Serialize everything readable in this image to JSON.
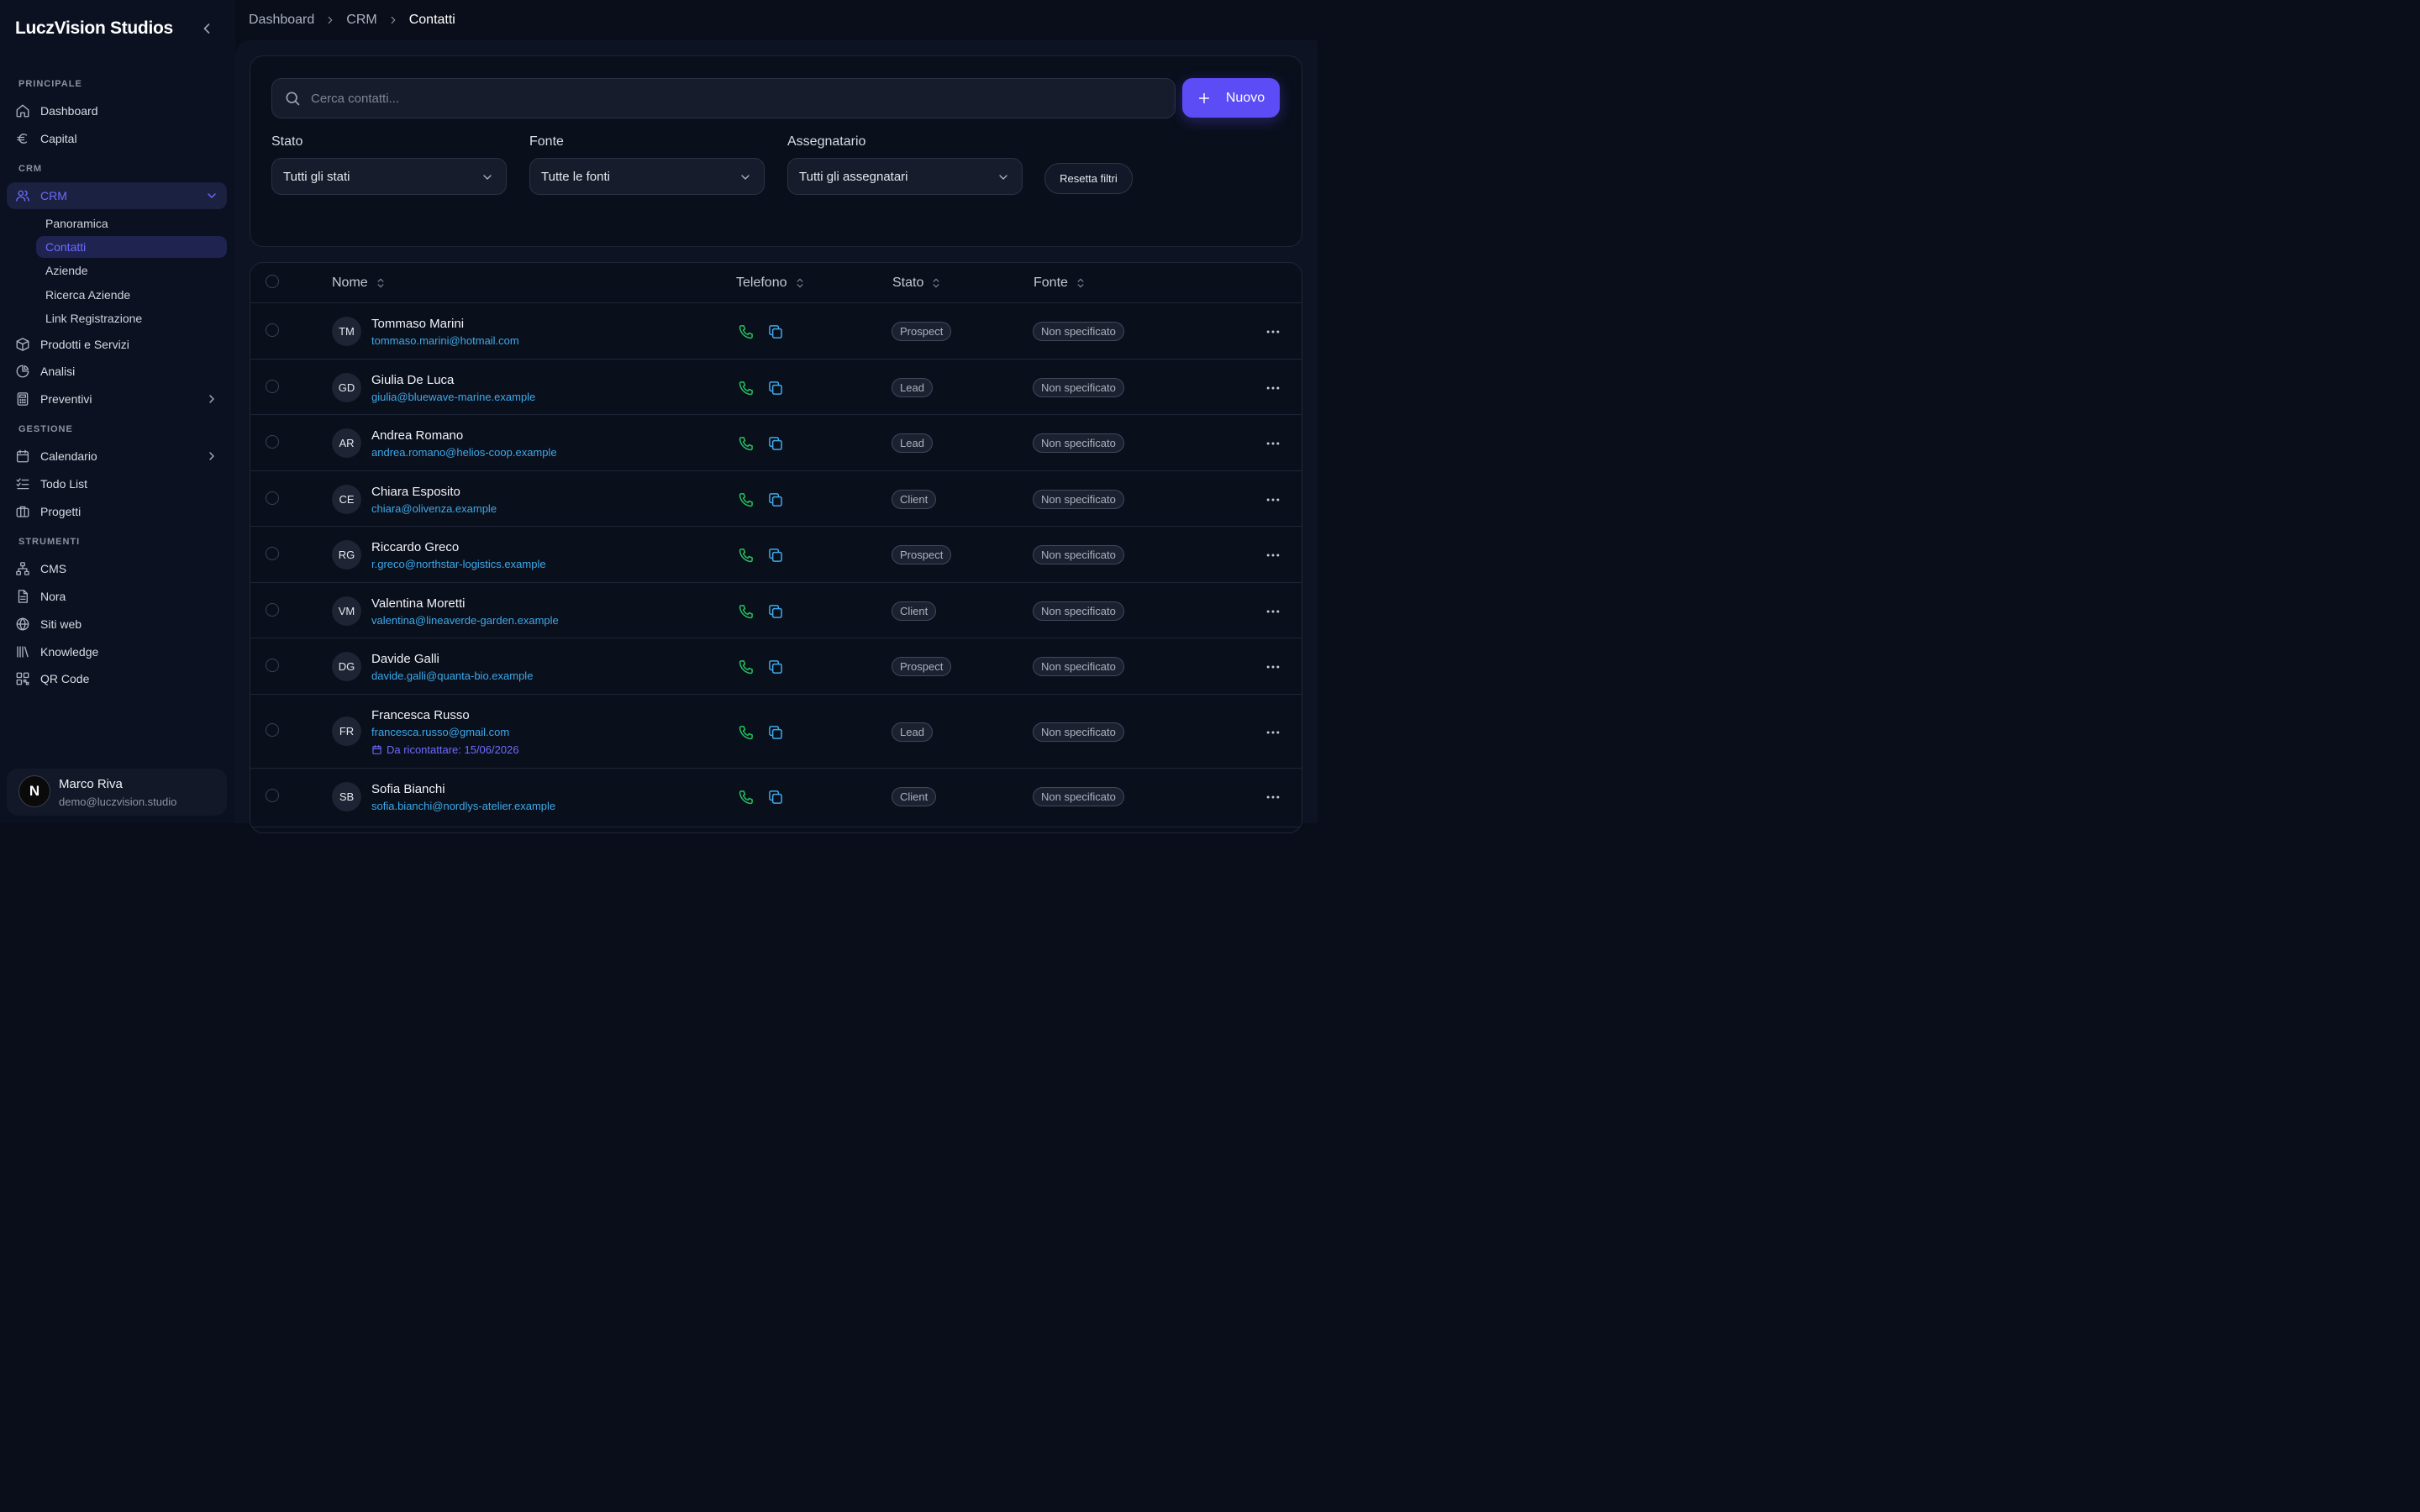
{
  "app": {
    "brand": "LuczVision Studios"
  },
  "sidebar": {
    "sections": {
      "principale": "PRINCIPALE",
      "crm": "CRM",
      "gestione": "GESTIONE",
      "strumenti": "STRUMENTI"
    },
    "items": {
      "dashboard": "Dashboard",
      "capital": "Capital",
      "crm": "CRM",
      "prodotti": "Prodotti e Servizi",
      "analisi": "Analisi",
      "preventivi": "Preventivi",
      "calendario": "Calendario",
      "todo": "Todo List",
      "progetti": "Progetti",
      "cms": "CMS",
      "nora": "Nora",
      "siti": "Siti web",
      "knowledge": "Knowledge",
      "qr": "QR Code"
    },
    "crm_sub": {
      "panoramica": "Panoramica",
      "contatti": "Contatti",
      "aziende": "Aziende",
      "ricerca": "Ricerca Aziende",
      "link": "Link Registrazione"
    },
    "user": {
      "initial": "N",
      "name": "Marco Riva",
      "email": "demo@luczvision.studio"
    }
  },
  "breadcrumb": {
    "items": [
      "Dashboard",
      "CRM"
    ],
    "current": "Contatti"
  },
  "toolbar": {
    "search_placeholder": "Cerca contatti...",
    "new_label": "Nuovo",
    "filters": {
      "stato": {
        "label": "Stato",
        "value": "Tutti gli stati"
      },
      "fonte": {
        "label": "Fonte",
        "value": "Tutte le fonti"
      },
      "assegnatario": {
        "label": "Assegnatario",
        "value": "Tutti gli assegnatari"
      }
    },
    "reset_label": "Resetta filtri"
  },
  "table": {
    "headers": {
      "nome": "Nome",
      "telefono": "Telefono",
      "stato": "Stato",
      "fonte": "Fonte"
    },
    "rows": [
      {
        "initials": "TM",
        "name": "Tommaso Marini",
        "email": "tommaso.marini@hotmail.com",
        "stato": "Prospect",
        "fonte": "Non specificato"
      },
      {
        "initials": "GD",
        "name": "Giulia De Luca",
        "email": "giulia@bluewave-marine.example",
        "stato": "Lead",
        "fonte": "Non specificato"
      },
      {
        "initials": "AR",
        "name": "Andrea Romano",
        "email": "andrea.romano@helios-coop.example",
        "stato": "Lead",
        "fonte": "Non specificato"
      },
      {
        "initials": "CE",
        "name": "Chiara Esposito",
        "email": "chiara@olivenza.example",
        "stato": "Client",
        "fonte": "Non specificato"
      },
      {
        "initials": "RG",
        "name": "Riccardo Greco",
        "email": "r.greco@northstar-logistics.example",
        "stato": "Prospect",
        "fonte": "Non specificato"
      },
      {
        "initials": "VM",
        "name": "Valentina Moretti",
        "email": "valentina@lineaverde-garden.example",
        "stato": "Client",
        "fonte": "Non specificato"
      },
      {
        "initials": "DG",
        "name": "Davide Galli",
        "email": "davide.galli@quanta-bio.example",
        "stato": "Prospect",
        "fonte": "Non specificato"
      },
      {
        "initials": "FR",
        "name": "Francesca Russo",
        "email": "francesca.russo@gmail.com",
        "recall": "Da ricontattare: 15/06/2026",
        "stato": "Lead",
        "fonte": "Non specificato"
      },
      {
        "initials": "SB",
        "name": "Sofia Bianchi",
        "email": "sofia.bianchi@nordlys-atelier.example",
        "stato": "Client",
        "fonte": "Non specificato"
      }
    ]
  },
  "colors": {
    "accent": "#5b4cf5",
    "active_text": "#6d6cff",
    "email": "#3da9e8",
    "phone": "#22c55e",
    "background": "#0a0e1a"
  }
}
